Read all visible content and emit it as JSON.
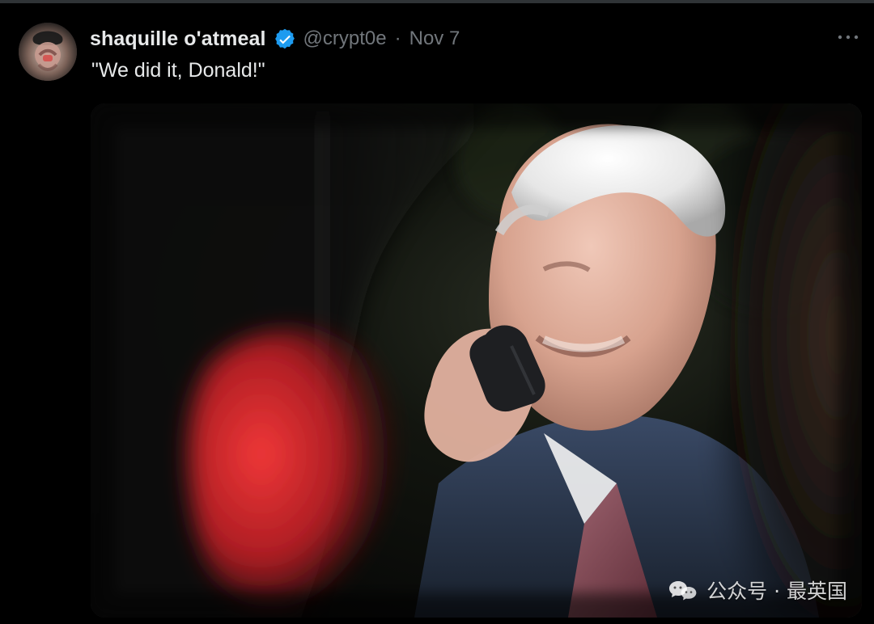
{
  "tweet": {
    "display_name": "shaquille o'atmeal",
    "handle": "@crypt0e",
    "separator": "·",
    "date": "Nov 7",
    "text": "\"We did it, Donald!\"",
    "verified_icon": "verified-badge-icon",
    "more_icon": "more-options-icon"
  },
  "media": {
    "watermark_text": "公众号 · 最英国",
    "watermark_icon": "wechat-icon"
  },
  "colors": {
    "background": "#000000",
    "primary_text": "#e7e9ea",
    "secondary_text": "#71767b",
    "verified_blue": "#1d9bf0",
    "divider": "#2f3336"
  }
}
